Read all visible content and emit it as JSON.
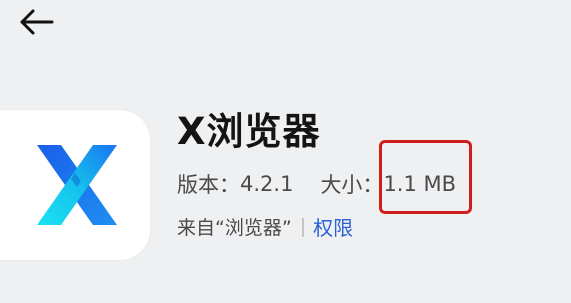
{
  "header": {
    "back_icon": "arrow-left-icon"
  },
  "app": {
    "icon": "x-browser-logo-icon",
    "name": "X浏览器",
    "version_label": "版本：",
    "version_value": "4.2.1",
    "size_label": "大小：",
    "size_value": "1.1 MB",
    "source_text": "来自“浏览器”",
    "divider": "|",
    "permissions_label": "权限"
  },
  "colors": {
    "background": "#eff0f2",
    "highlight_box": "#d01e1e",
    "link": "#2b62d6",
    "logo_blue": "#1f7ff0",
    "logo_cyan": "#15d5ee"
  }
}
